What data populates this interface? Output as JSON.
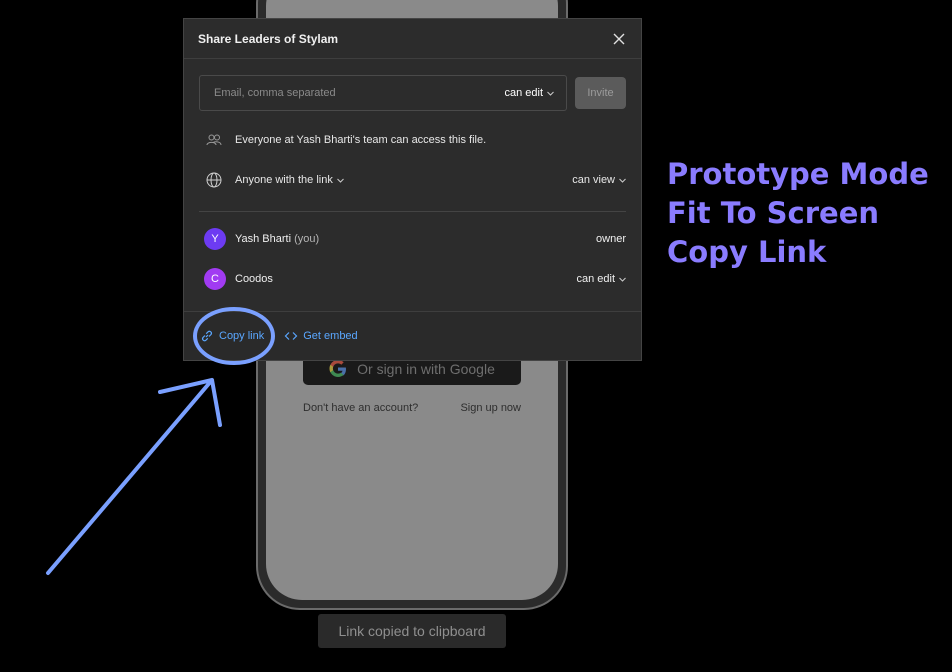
{
  "modal": {
    "title": "Share Leaders of Stylam",
    "email_placeholder": "Email, comma separated",
    "invite_permission": "can edit",
    "invite_label": "Invite",
    "team_access_text": "Everyone at Yash Bharti's team can access this file.",
    "link_access_label": "Anyone with the link",
    "link_permission": "can view",
    "members": [
      {
        "initial": "Y",
        "name": "Yash Bharti",
        "suffix": "(you)",
        "role": "owner",
        "color": "#6d3bf2"
      },
      {
        "initial": "C",
        "name": "Coodos",
        "suffix": "",
        "role": "can edit",
        "color": "#a13bf2"
      }
    ],
    "copy_link_label": "Copy link",
    "get_embed_label": "Get embed"
  },
  "background_phone": {
    "google_button_label": "Or sign in with Google",
    "no_account_text": "Don't have an account?",
    "sign_up_label": "Sign up now"
  },
  "annotation": {
    "lines": [
      "Prototype Mode",
      "Fit To Screen",
      "Copy Link"
    ],
    "color": "#8a7cff"
  },
  "toast": {
    "text": "Link copied to clipboard"
  },
  "colors": {
    "accent_link": "#5aa7ff",
    "annotation_stroke": "#7aa0ff"
  }
}
